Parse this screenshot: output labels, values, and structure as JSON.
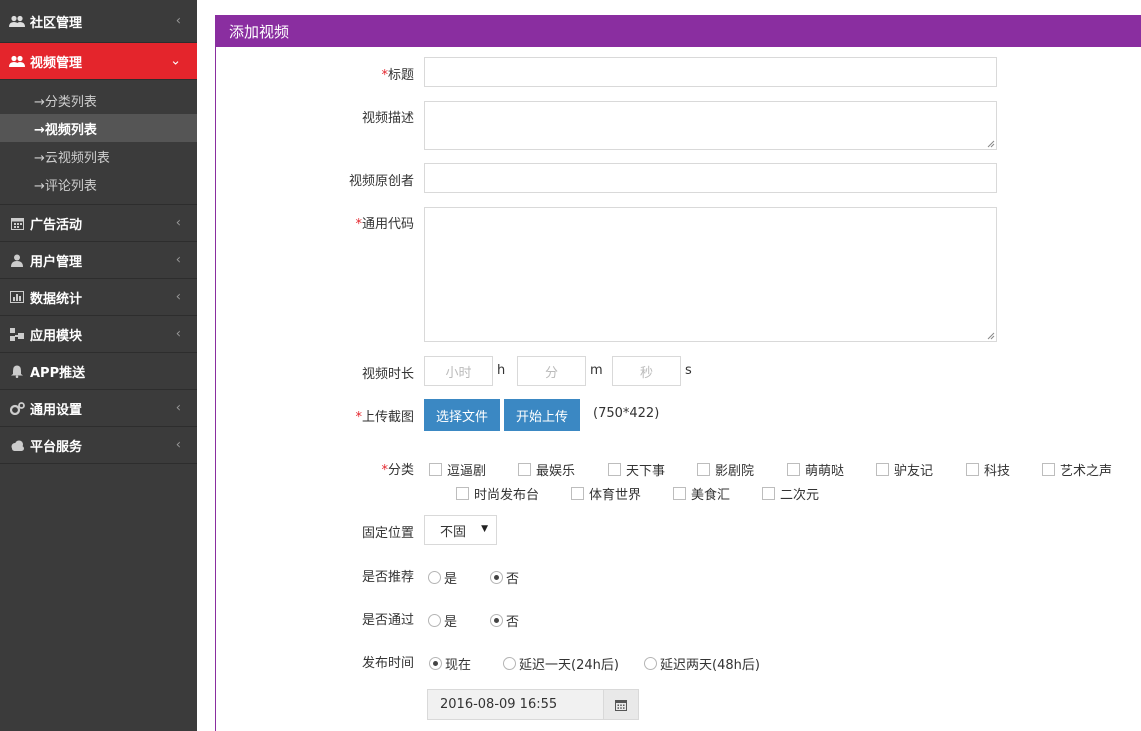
{
  "sidebar": {
    "items": [
      {
        "label": "社区管理",
        "icon": "users-icon"
      },
      {
        "label": "视频管理",
        "icon": "users-icon",
        "active": true
      },
      {
        "label": "广告活动",
        "icon": "calendar-icon"
      },
      {
        "label": "用户管理",
        "icon": "user-icon"
      },
      {
        "label": "数据统计",
        "icon": "bar-chart-icon"
      },
      {
        "label": "应用模块",
        "icon": "sitemap-icon"
      },
      {
        "label": "APP推送",
        "icon": "bell-icon"
      },
      {
        "label": "通用设置",
        "icon": "cogs-icon"
      },
      {
        "label": "平台服务",
        "icon": "cloud-icon"
      }
    ],
    "subitems": [
      {
        "label": "→分类列表"
      },
      {
        "label": "→视频列表",
        "active": true
      },
      {
        "label": "→云视频列表"
      },
      {
        "label": "→评论列表"
      }
    ]
  },
  "panel": {
    "title": "添加视频"
  },
  "form": {
    "title_label": "标题",
    "desc_label": "视频描述",
    "author_label": "视频原创者",
    "code_label": "通用代码",
    "duration_label": "视频时长",
    "duration": {
      "hour_placeholder": "小时",
      "hour_unit": "h",
      "min_placeholder": "分",
      "min_unit": "m",
      "sec_placeholder": "秒",
      "sec_unit": "s"
    },
    "upload_label": "上传截图",
    "choose_file": "选择文件",
    "start_upload": "开始上传",
    "size_hint": "(750*422)",
    "category_label": "分类",
    "categories": [
      "逗逼剧",
      "最娱乐",
      "天下事",
      "影剧院",
      "萌萌哒",
      "驴友记",
      "科技",
      "艺术之声",
      "时尚发布台",
      "体育世界",
      "美食汇",
      "二次元"
    ],
    "position_label": "固定位置",
    "position_value": "不固",
    "recommend_label": "是否推荐",
    "recommend_yes": "是",
    "recommend_no": "否",
    "approve_label": "是否通过",
    "approve_yes": "是",
    "approve_no": "否",
    "publish_label": "发布时间",
    "publish_now": "现在",
    "publish_1day": "延迟一天(24h后)",
    "publish_2day": "延迟两天(48h后)",
    "publish_datetime": "2016-08-09 16:55",
    "required_mark": "*"
  },
  "colors": {
    "sidebar_bg": "#3b3b3b",
    "active_menu": "#e4252c",
    "panel_header": "#8a2ea0",
    "button": "#3b88c3"
  }
}
